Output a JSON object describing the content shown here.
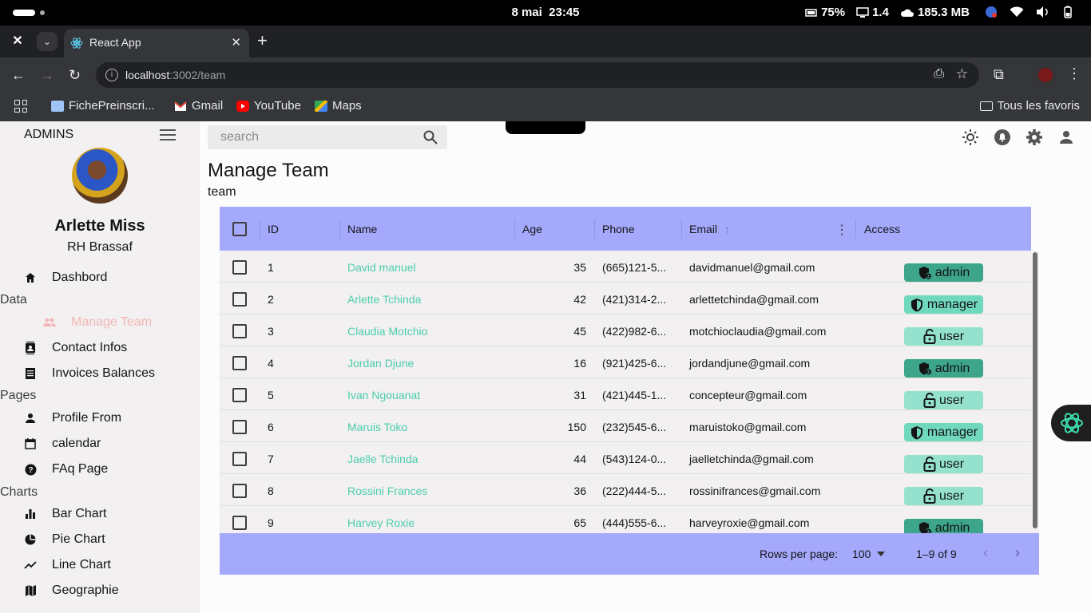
{
  "os": {
    "date": "8 mai",
    "time": "23:45",
    "battery": "75%",
    "cpu": "1.4",
    "network": "185.3 MB"
  },
  "browser": {
    "tab_title": "React App",
    "url_host": "localhost",
    "url_path": ":3002/team",
    "bookmarks": [
      "FichePreinscri...",
      "Gmail",
      "YouTube",
      "Maps"
    ],
    "all_favorites": "Tous les favoris"
  },
  "sidebar": {
    "brand": "ADMINS",
    "user_name": "Arlette Miss",
    "user_role": "RH Brassaf",
    "dashboard": "Dashbord",
    "sections": {
      "data": "Data",
      "pages": "Pages",
      "charts": "Charts"
    },
    "data_items": [
      "Manage Team",
      "Contact Infos",
      "Invoices Balances"
    ],
    "page_items": [
      "Profile From",
      "calendar",
      "FAq Page"
    ],
    "chart_items": [
      "Bar Chart",
      "Pie Chart",
      "Line Chart",
      "Geographie"
    ]
  },
  "topbar": {
    "search_placeholder": "search"
  },
  "page": {
    "title": "Manage Team",
    "subtitle": "team"
  },
  "table": {
    "columns": [
      "ID",
      "Name",
      "Age",
      "Phone",
      "Email",
      "Access"
    ],
    "rows": [
      {
        "id": "1",
        "name": "David manuel",
        "age": "35",
        "phone": "(665)121-5...",
        "email": "davidmanuel@gmail.com",
        "access": "admin"
      },
      {
        "id": "2",
        "name": "Arlette Tchinda",
        "age": "42",
        "phone": "(421)314-2...",
        "email": "arlettetchinda@gmail.com",
        "access": "manager"
      },
      {
        "id": "3",
        "name": "Claudia Motchio",
        "age": "45",
        "phone": "(422)982-6...",
        "email": "motchioclaudia@gmail.com",
        "access": "user"
      },
      {
        "id": "4",
        "name": "Jordan Djune",
        "age": "16",
        "phone": "(921)425-6...",
        "email": "jordandjune@gmail.com",
        "access": "admin"
      },
      {
        "id": "5",
        "name": "Ivan Ngouanat",
        "age": "31",
        "phone": "(421)445-1...",
        "email": "concepteur@gmail.com",
        "access": "user"
      },
      {
        "id": "6",
        "name": "Maruis Toko",
        "age": "150",
        "phone": "(232)545-6...",
        "email": "maruistoko@gmail.com",
        "access": "manager"
      },
      {
        "id": "7",
        "name": "Jaelle Tchinda",
        "age": "44",
        "phone": "(543)124-0...",
        "email": "jaelletchinda@gmail.com",
        "access": "user"
      },
      {
        "id": "8",
        "name": "Rossini Frances",
        "age": "36",
        "phone": "(222)444-5...",
        "email": "rossinifrances@gmail.com",
        "access": "user"
      },
      {
        "id": "9",
        "name": "Harvey Roxie",
        "age": "65",
        "phone": "(444)555-6...",
        "email": "harveyroxie@gmail.com",
        "access": "admin"
      }
    ],
    "rows_per_page_label": "Rows per page:",
    "rows_per_page": "100",
    "range": "1–9 of 9"
  }
}
